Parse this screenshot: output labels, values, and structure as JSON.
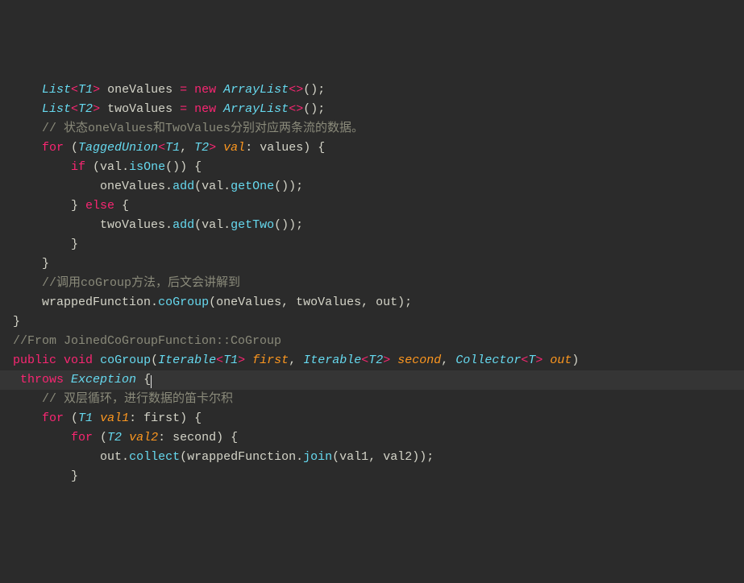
{
  "code_lines": [
    {
      "indent": "    ",
      "segs": [
        [
          "type",
          "List"
        ],
        [
          "gen",
          "<"
        ],
        [
          "type",
          "T1"
        ],
        [
          "gen",
          ">"
        ],
        [
          "id",
          " oneValues "
        ],
        [
          "op",
          "="
        ],
        [
          "id",
          " "
        ],
        [
          "kw",
          "new"
        ],
        [
          "id",
          " "
        ],
        [
          "type",
          "ArrayList"
        ],
        [
          "gen",
          "<>"
        ],
        [
          "punc",
          "();"
        ]
      ]
    },
    {
      "indent": "    ",
      "segs": [
        [
          "type",
          "List"
        ],
        [
          "gen",
          "<"
        ],
        [
          "type",
          "T2"
        ],
        [
          "gen",
          ">"
        ],
        [
          "id",
          " twoValues "
        ],
        [
          "op",
          "="
        ],
        [
          "id",
          " "
        ],
        [
          "kw",
          "new"
        ],
        [
          "id",
          " "
        ],
        [
          "type",
          "ArrayList"
        ],
        [
          "gen",
          "<>"
        ],
        [
          "punc",
          "();"
        ]
      ]
    },
    {
      "indent": "",
      "segs": []
    },
    {
      "indent": "    ",
      "segs": [
        [
          "comment",
          "// 状态oneValues和TwoValues分别对应两条流的数据。"
        ]
      ]
    },
    {
      "indent": "    ",
      "segs": [
        [
          "kw",
          "for"
        ],
        [
          "punc",
          " ("
        ],
        [
          "type",
          "TaggedUnion"
        ],
        [
          "gen",
          "<"
        ],
        [
          "type",
          "T1"
        ],
        [
          "punc",
          ", "
        ],
        [
          "type",
          "T2"
        ],
        [
          "gen",
          ">"
        ],
        [
          "id",
          " "
        ],
        [
          "param",
          "val"
        ],
        [
          "punc",
          ": "
        ],
        [
          "id",
          "values"
        ],
        [
          "punc",
          ") {"
        ]
      ]
    },
    {
      "indent": "        ",
      "segs": [
        [
          "kw",
          "if"
        ],
        [
          "punc",
          " ("
        ],
        [
          "id",
          "val"
        ],
        [
          "punc",
          "."
        ],
        [
          "fn",
          "isOne"
        ],
        [
          "punc",
          "()) {"
        ]
      ]
    },
    {
      "indent": "            ",
      "segs": [
        [
          "id",
          "oneValues"
        ],
        [
          "punc",
          "."
        ],
        [
          "fn",
          "add"
        ],
        [
          "punc",
          "("
        ],
        [
          "id",
          "val"
        ],
        [
          "punc",
          "."
        ],
        [
          "fn",
          "getOne"
        ],
        [
          "punc",
          "());"
        ]
      ]
    },
    {
      "indent": "        ",
      "segs": [
        [
          "punc",
          "} "
        ],
        [
          "kw",
          "else"
        ],
        [
          "punc",
          " {"
        ]
      ]
    },
    {
      "indent": "            ",
      "segs": [
        [
          "id",
          "twoValues"
        ],
        [
          "punc",
          "."
        ],
        [
          "fn",
          "add"
        ],
        [
          "punc",
          "("
        ],
        [
          "id",
          "val"
        ],
        [
          "punc",
          "."
        ],
        [
          "fn",
          "getTwo"
        ],
        [
          "punc",
          "());"
        ]
      ]
    },
    {
      "indent": "        ",
      "segs": [
        [
          "punc",
          "}"
        ]
      ]
    },
    {
      "indent": "    ",
      "segs": [
        [
          "punc",
          "}"
        ]
      ]
    },
    {
      "indent": "",
      "segs": []
    },
    {
      "indent": "    ",
      "segs": [
        [
          "comment",
          "//调用coGroup方法，后文会讲解到"
        ]
      ]
    },
    {
      "indent": "    ",
      "segs": [
        [
          "id",
          "wrappedFunction"
        ],
        [
          "punc",
          "."
        ],
        [
          "fn",
          "coGroup"
        ],
        [
          "punc",
          "("
        ],
        [
          "id",
          "oneValues"
        ],
        [
          "punc",
          ", "
        ],
        [
          "id",
          "twoValues"
        ],
        [
          "punc",
          ", "
        ],
        [
          "id",
          "out"
        ],
        [
          "punc",
          ");"
        ]
      ]
    },
    {
      "indent": "",
      "segs": [
        [
          "punc",
          "}"
        ]
      ]
    },
    {
      "indent": "",
      "segs": []
    },
    {
      "indent": "",
      "segs": [
        [
          "comment",
          "//From JoinedCoGroupFunction::CoGroup"
        ]
      ]
    },
    {
      "indent": "",
      "segs": [
        [
          "kw",
          "public"
        ],
        [
          "id",
          " "
        ],
        [
          "kw",
          "void"
        ],
        [
          "id",
          " "
        ],
        [
          "fn",
          "coGroup"
        ],
        [
          "punc",
          "("
        ],
        [
          "type",
          "Iterable"
        ],
        [
          "gen",
          "<"
        ],
        [
          "type",
          "T1"
        ],
        [
          "gen",
          ">"
        ],
        [
          "id",
          " "
        ],
        [
          "param",
          "first"
        ],
        [
          "punc",
          ", "
        ],
        [
          "type",
          "Iterable"
        ],
        [
          "gen",
          "<"
        ],
        [
          "type",
          "T2"
        ],
        [
          "gen",
          ">"
        ],
        [
          "id",
          " "
        ],
        [
          "param",
          "second"
        ],
        [
          "punc",
          ", "
        ],
        [
          "type",
          "Collector"
        ],
        [
          "gen",
          "<"
        ],
        [
          "type",
          "T"
        ],
        [
          "gen",
          ">"
        ],
        [
          "id",
          " "
        ],
        [
          "param",
          "out"
        ],
        [
          "punc",
          ")"
        ]
      ]
    },
    {
      "indent": " ",
      "cursor": true,
      "segs": [
        [
          "kw",
          "throws"
        ],
        [
          "id",
          " "
        ],
        [
          "type",
          "Exception"
        ],
        [
          "punc",
          " {"
        ]
      ]
    },
    {
      "indent": "    ",
      "segs": [
        [
          "comment",
          "// 双层循环，进行数据的笛卡尔积"
        ]
      ]
    },
    {
      "indent": "    ",
      "segs": [
        [
          "kw",
          "for"
        ],
        [
          "punc",
          " ("
        ],
        [
          "type",
          "T1"
        ],
        [
          "id",
          " "
        ],
        [
          "param",
          "val1"
        ],
        [
          "punc",
          ": "
        ],
        [
          "id",
          "first"
        ],
        [
          "punc",
          ") {"
        ]
      ]
    },
    {
      "indent": "        ",
      "segs": [
        [
          "kw",
          "for"
        ],
        [
          "punc",
          " ("
        ],
        [
          "type",
          "T2"
        ],
        [
          "id",
          " "
        ],
        [
          "param",
          "val2"
        ],
        [
          "punc",
          ": "
        ],
        [
          "id",
          "second"
        ],
        [
          "punc",
          ") {"
        ]
      ]
    },
    {
      "indent": "            ",
      "segs": [
        [
          "id",
          "out"
        ],
        [
          "punc",
          "."
        ],
        [
          "fn",
          "collect"
        ],
        [
          "punc",
          "("
        ],
        [
          "id",
          "wrappedFunction"
        ],
        [
          "punc",
          "."
        ],
        [
          "fn",
          "join"
        ],
        [
          "punc",
          "("
        ],
        [
          "id",
          "val1"
        ],
        [
          "punc",
          ", "
        ],
        [
          "id",
          "val2"
        ],
        [
          "punc",
          "));"
        ]
      ]
    },
    {
      "indent": "        ",
      "segs": [
        [
          "punc",
          "}"
        ]
      ]
    }
  ]
}
